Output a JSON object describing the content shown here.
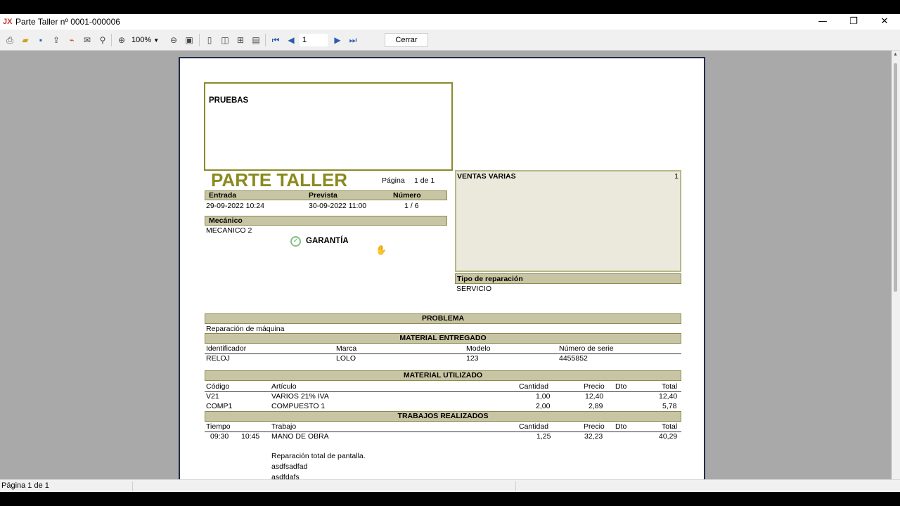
{
  "window": {
    "title": "Parte Taller nº 0001-000006",
    "minimize": "—",
    "maximize": "❐",
    "close": "✕"
  },
  "toolbar": {
    "zoom": "100%",
    "page": "1",
    "close_label": "Cerrar"
  },
  "status": {
    "page_text": "Página 1 de 1"
  },
  "report": {
    "company_box": "PRUEBAS",
    "doc_title": "PARTE TALLER",
    "page_label": "Página",
    "page_value": "1 de  1",
    "entrada_h": "Entrada",
    "prevista_h": "Prevista",
    "numero_h": "Número",
    "entrada": "29-09-2022   10:24",
    "prevista": "30-09-2022   11:00",
    "numero": "1 /  6",
    "mecanico_h": "Mecánico",
    "mecanico": "MECANICO 2",
    "garantia": "GARANTÍA",
    "client_box": "VENTAS VARIAS",
    "client_num": "1",
    "tipo_h": "Tipo de reparación",
    "tipo": "SERVICIO",
    "problema_h": "PROBLEMA",
    "problema": "Reparación de máquina",
    "entregado_h": "MATERIAL ENTREGADO",
    "entregado_cols": [
      "Identificador",
      "Marca",
      "Modelo",
      "Número de serie"
    ],
    "entregado_row": [
      "RELOJ",
      "LOLO",
      "123",
      "4455852"
    ],
    "utilizado_h": "MATERIAL UTILIZADO",
    "utilizado_cols": [
      "Código",
      "Artículo",
      "Cantidad",
      "Precio",
      "Dto",
      "Total"
    ],
    "utilizado_rows": [
      [
        "V21",
        "VARIOS 21% IVA",
        "1,00",
        "12,40",
        "",
        "12,40"
      ],
      [
        "COMP1",
        "COMPUESTO 1",
        "2,00",
        "2,89",
        "",
        "5,78"
      ]
    ],
    "trabajos_h": "TRABAJOS REALIZADOS",
    "trabajos_cols": [
      "Tiempo",
      "Trabajo",
      "Cantidad",
      "Precio",
      "Dto",
      "Total"
    ],
    "trabajos_row": {
      "start": "09:30",
      "end": "10:45",
      "trabajo": "MANO DE OBRA",
      "cantidad": "1,25",
      "precio": "32,23",
      "total": "40,29"
    },
    "notes": [
      "Reparación total de pantalla.",
      "asdfsadfad",
      "asdfdafs"
    ]
  }
}
